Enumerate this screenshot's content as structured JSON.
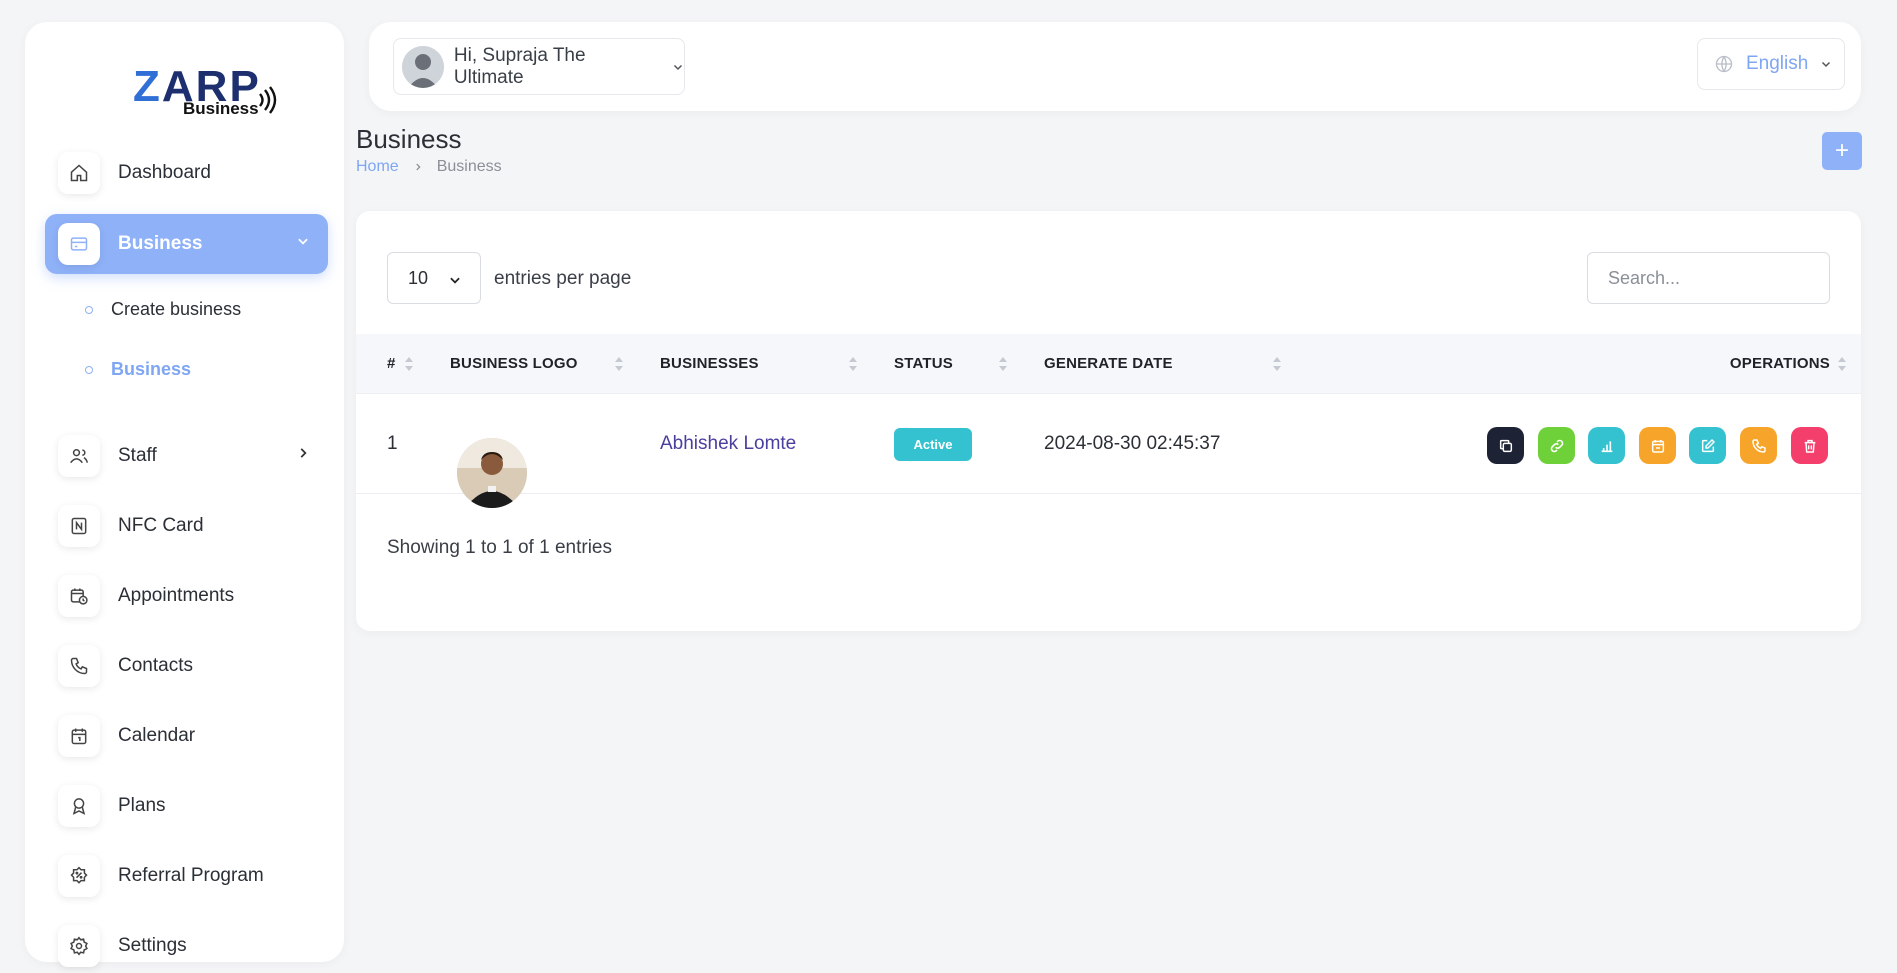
{
  "brand": {
    "logo_text": "ZARP",
    "logo_sub": "Business"
  },
  "sidebar": {
    "items": [
      {
        "label": "Dashboard",
        "icon": "home-icon"
      },
      {
        "label": "Business",
        "icon": "credit-card-icon",
        "active": true,
        "expanded": true
      },
      {
        "label": "Staff",
        "icon": "users-icon"
      },
      {
        "label": "NFC Card",
        "icon": "nfc-icon"
      },
      {
        "label": "Appointments",
        "icon": "calendar-clock-icon"
      },
      {
        "label": "Contacts",
        "icon": "phone-icon"
      },
      {
        "label": "Calendar",
        "icon": "calendar-icon"
      },
      {
        "label": "Plans",
        "icon": "award-icon"
      },
      {
        "label": "Referral Program",
        "icon": "discount-icon"
      },
      {
        "label": "Settings",
        "icon": "gear-icon"
      }
    ],
    "sub_items": [
      {
        "label": "Create business"
      },
      {
        "label": "Business",
        "current": true
      }
    ]
  },
  "topbar": {
    "greeting": "Hi, Supraja The Ultimate",
    "language": "English"
  },
  "page": {
    "title": "Business",
    "breadcrumb": {
      "home": "Home",
      "current": "Business"
    },
    "add_label": "+"
  },
  "table": {
    "per_page_value": "10",
    "per_page_label": "entries per page",
    "search_placeholder": "Search...",
    "columns": [
      "#",
      "BUSINESS LOGO",
      "BUSINESSES",
      "STATUS",
      "GENERATE DATE",
      "OPERATIONS"
    ],
    "rows": [
      {
        "index": "1",
        "name": "Abhishek Lomte",
        "status": "Active",
        "date": "2024-08-30 02:45:37"
      }
    ],
    "operations": [
      {
        "name": "copy-icon",
        "color": "#1e2235"
      },
      {
        "name": "link-icon",
        "color": "#6fd13a"
      },
      {
        "name": "analytics-icon",
        "color": "#35c2d0"
      },
      {
        "name": "calendar-icon",
        "color": "#f7a52a"
      },
      {
        "name": "edit-icon",
        "color": "#35c2d0"
      },
      {
        "name": "phone-icon",
        "color": "#f7a52a"
      },
      {
        "name": "trash-icon",
        "color": "#f43f6d"
      }
    ],
    "footer": "Showing 1 to 1 of 1 entries"
  },
  "colors": {
    "accent": "#8fb1f8",
    "link": "#7fa6f3",
    "status_active": "#35c2d0",
    "name_link": "#4a3f9e"
  }
}
